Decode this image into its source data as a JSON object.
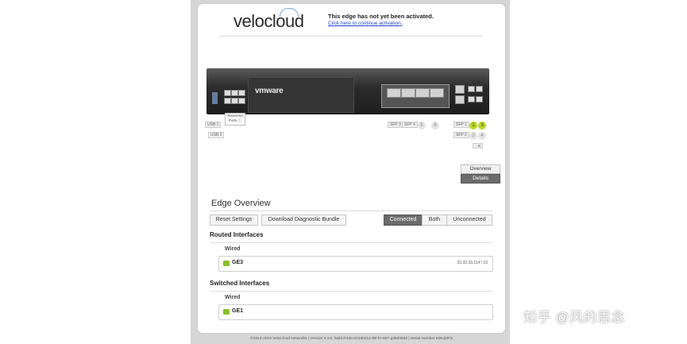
{
  "header": {
    "logo_text": "velocloud",
    "activation_title": "This edge has not yet been activated.",
    "activation_link": "Click here to continue activation",
    "activation_link_tail": "."
  },
  "device": {
    "brand": "vmware",
    "reserved_label": "Reserved Ports",
    "usb_labels": [
      "USB 1",
      "USB 2"
    ],
    "sfp_labels": [
      "SFP 3",
      "SFP 4"
    ],
    "middle_ports": [
      "5",
      "6"
    ],
    "right_sfp_labels": [
      "SFP 1",
      "SFP 2"
    ],
    "right_ports": [
      "1",
      "3",
      "2",
      "4"
    ],
    "active_ports": [
      "1",
      "3"
    ],
    "highlight_color": "#b8d82a"
  },
  "view_toggle": {
    "overview_label": "Overview",
    "details_label": "Details",
    "selected": "Details"
  },
  "overview": {
    "title": "Edge Overview",
    "reset_button": "Reset Settings",
    "download_button": "Download Diagnostic Bundle",
    "filters": [
      "Connected",
      "Both",
      "Unconnected"
    ],
    "active_filter": "Connected"
  },
  "routed": {
    "title": "Routed Interfaces",
    "subtitle": "Wired",
    "interfaces": [
      {
        "name": "GE3",
        "ip": "10.33.33.114 / 23"
      }
    ]
  },
  "switched": {
    "title": "Switched Interfaces",
    "subtitle": "Wired",
    "interfaces": [
      {
        "name": "GE1"
      }
    ]
  },
  "footer": {
    "text": "©2013-2019 VeloCloud Networks | Version 3.3.0, build R330-20190212-BETA-567-g38d46d2 | Serial Number 6DKZZF3"
  },
  "watermark": "知乎 @风的思念",
  "accent_color": "#8cbf2b"
}
